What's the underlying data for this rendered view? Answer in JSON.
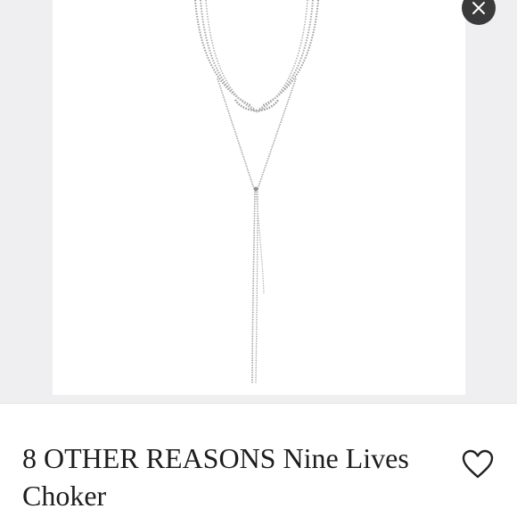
{
  "listing": {
    "title": "8 OTHER REASONS Nine Lives Choker"
  },
  "icons": {
    "close": "close-icon",
    "like": "heart-icon"
  },
  "colors": {
    "photo_background": "#efeff1",
    "close_button": "#3a3a3a",
    "text": "#1e1e1e"
  }
}
